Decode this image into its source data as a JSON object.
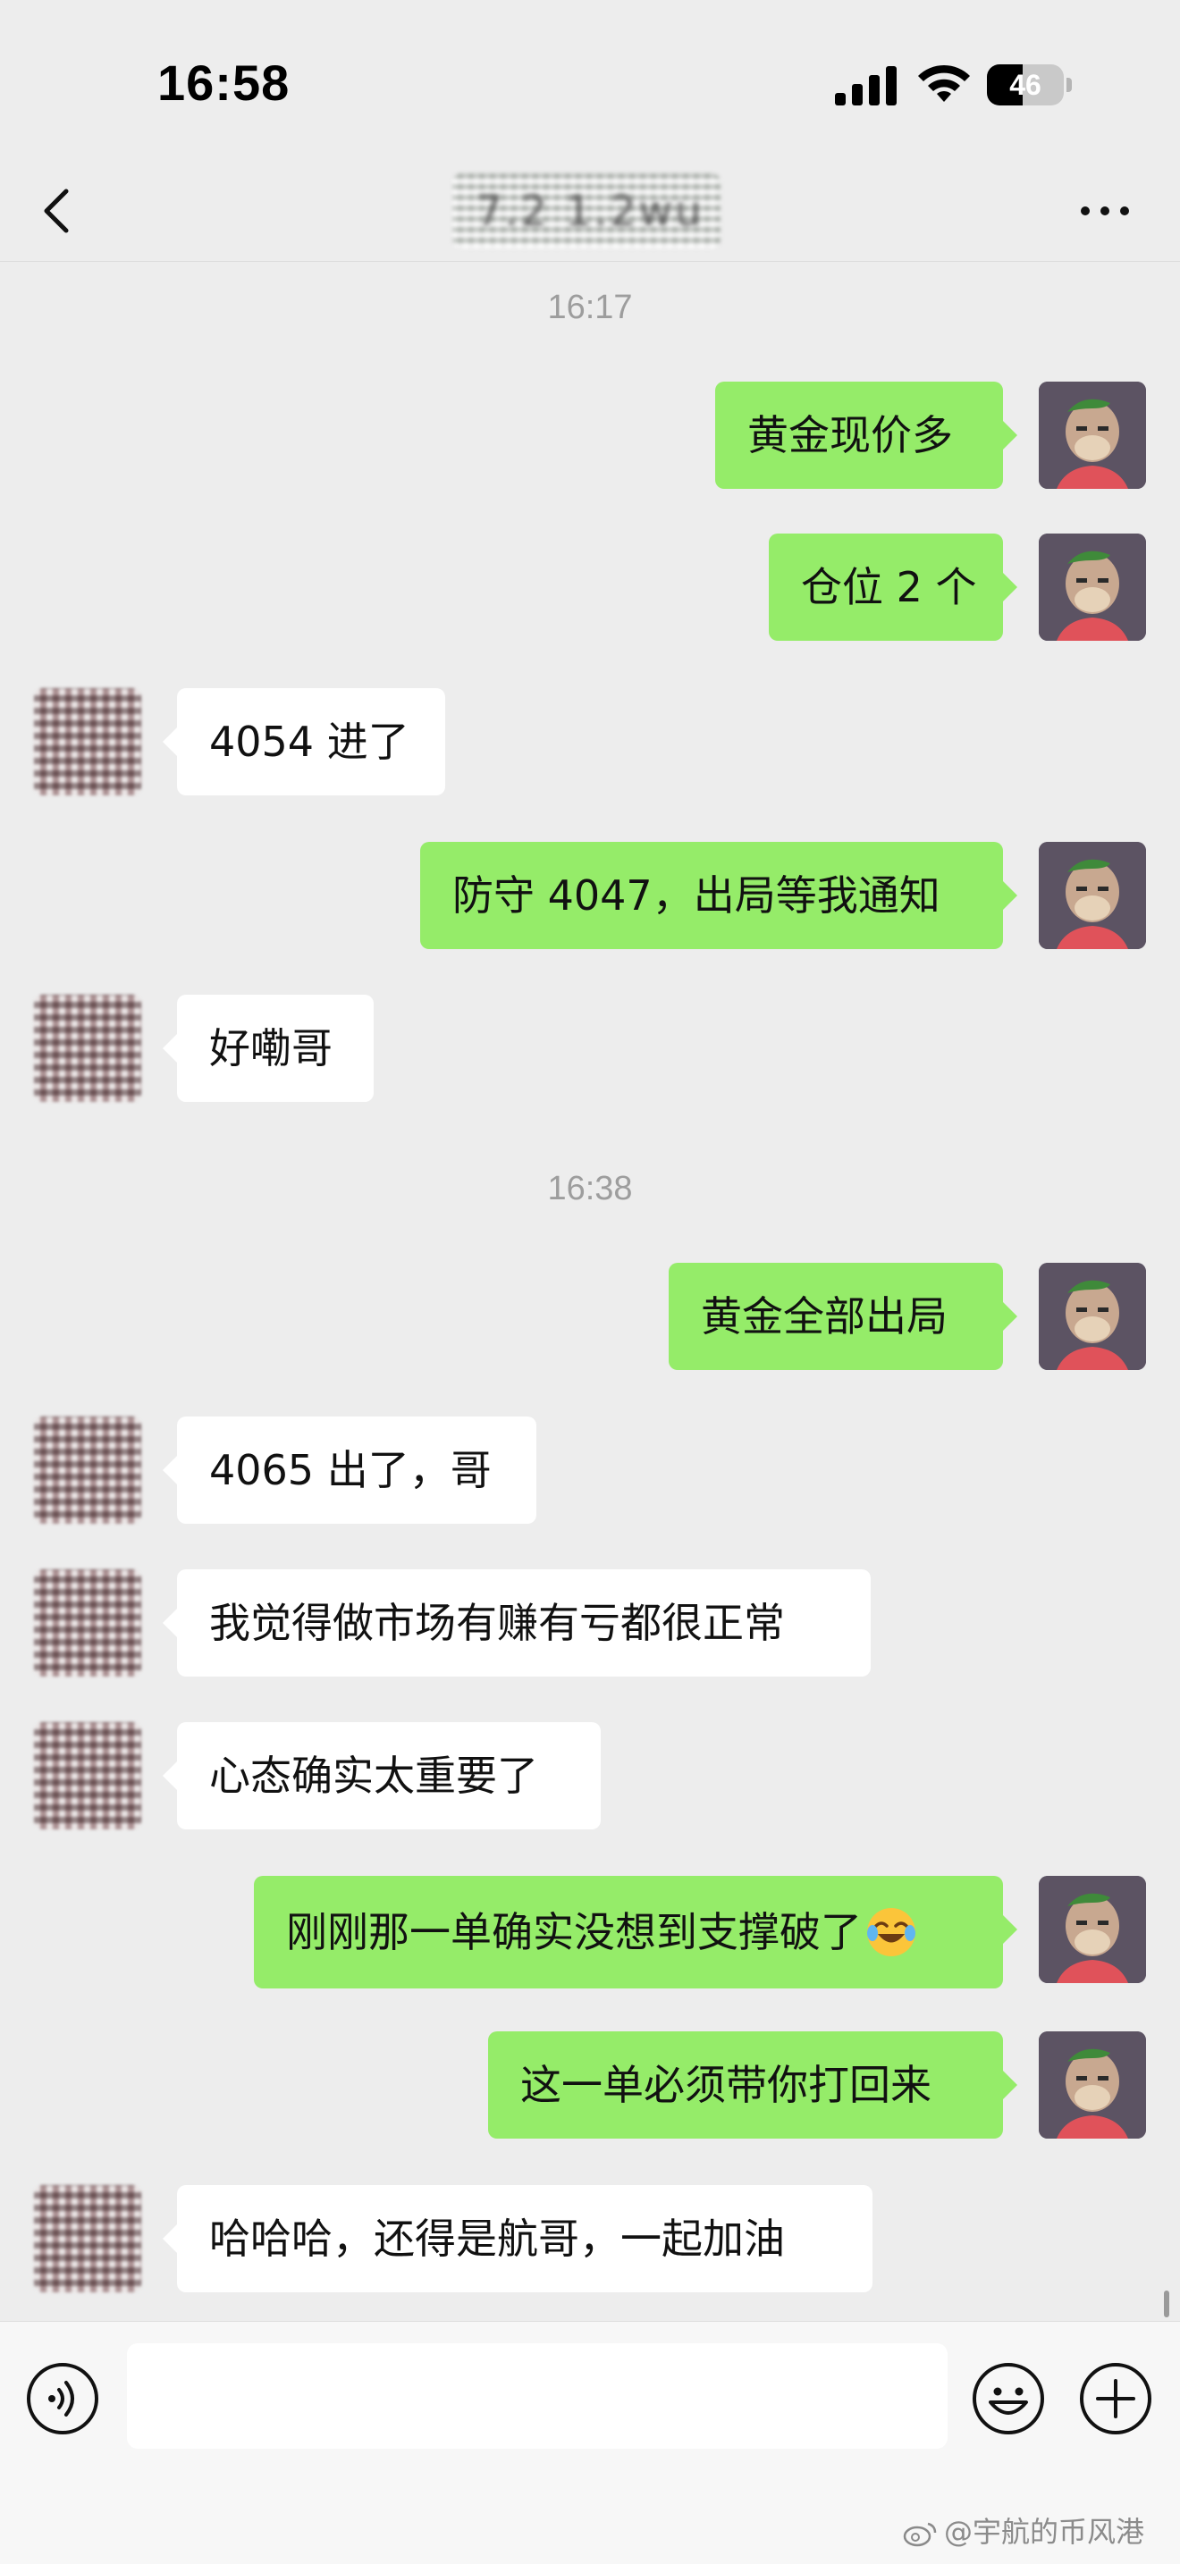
{
  "status_bar": {
    "time": "16:58",
    "battery_level": "46",
    "battery_fraction": 0.46,
    "signal_icon": "cellular-signal-icon",
    "wifi_icon": "wifi-icon"
  },
  "nav": {
    "title": "7.2        1.2wu",
    "back_icon": "chevron-left-icon",
    "more_icon": "more-dots-icon"
  },
  "messages": {
    "ts1": "16:17",
    "m1": "黄金现价多",
    "m2": "仓位 2 个",
    "m3": "4054 进了",
    "m4": "防守 4047，出局等我通知",
    "m5": "好嘞哥",
    "ts2": "16:38",
    "m6": "黄金全部出局",
    "m7": "4065 出了，哥",
    "m8": "我觉得做市场有赚有亏都很正常",
    "m9": "心态确实太重要了",
    "m10": "刚刚那一单确实没想到支撑破了",
    "m10_emoji": "laughing-crying-emoji",
    "m11": "这一单必须带你打回来",
    "m12": "哈哈哈，还得是航哥，一起加油"
  },
  "input_bar": {
    "placeholder": "",
    "voice_icon": "voice-input-icon",
    "emoji_icon": "emoji-smile-icon",
    "add_icon": "plus-circle-icon"
  },
  "watermark": {
    "text": "@宇航的币风港",
    "logo": "weibo-logo-icon"
  },
  "colors": {
    "self_bubble": "#95ec69",
    "other_bubble": "#ffffff",
    "background": "#ededed"
  }
}
